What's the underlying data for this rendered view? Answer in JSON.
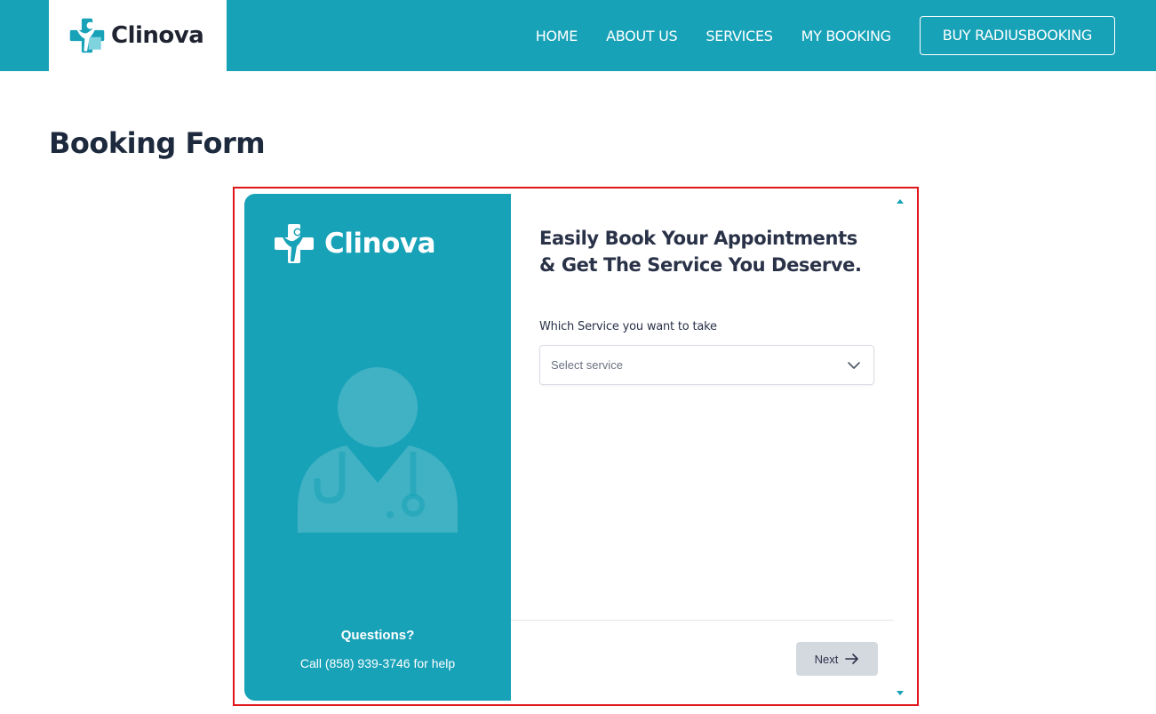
{
  "header": {
    "brand": "Clinova",
    "nav": [
      {
        "label": "HOME"
      },
      {
        "label": "ABOUT US"
      },
      {
        "label": "SERVICES"
      },
      {
        "label": "MY BOOKING"
      }
    ],
    "cta_label": "BUY RADIUSBOOKING"
  },
  "page": {
    "title": "Booking Form"
  },
  "booking": {
    "sidebar": {
      "brand": "Clinova",
      "questions_title": "Questions?",
      "call_text": "Call (858) 939-3746 for help"
    },
    "heading": "Easily Book Your Appointments & Get The Service You Deserve.",
    "service_label": "Which Service you want to take",
    "service_placeholder": "Select service",
    "next_label": "Next"
  },
  "icons": {
    "logo": "clinova-cross-person-icon",
    "doctor": "doctor-illustration-icon",
    "chevron": "chevron-down-icon",
    "next_arrow": "arrow-right-icon"
  },
  "colors": {
    "brand_teal": "#18a2b8",
    "frame_red": "#e0161a",
    "text_dark": "#2a3248",
    "button_gray": "#d4d8df"
  }
}
